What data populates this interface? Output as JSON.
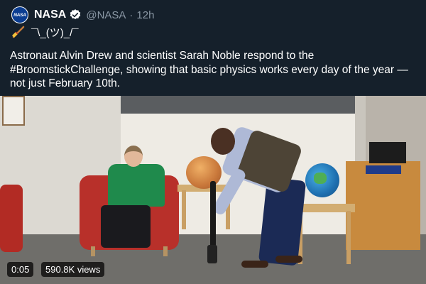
{
  "tweet": {
    "author": {
      "avatar_text": "NASA",
      "display_name": "NASA",
      "verified_icon": "verified-badge-icon",
      "handle": "@NASA",
      "separator": "·",
      "timestamp": "12h"
    },
    "emoji_line": {
      "emoji_icon": "broom-emoji-icon",
      "shrug": "¯\\_(ツ)_/¯"
    },
    "text": "Astronaut Alvin Drew and scientist Sarah Noble respond to the #BroomstickChallenge, showing that basic physics works every day of the year — not just February 10th."
  },
  "video": {
    "elapsed": "0:05",
    "views": "590.8K views"
  },
  "colors": {
    "background": "#15202b",
    "verified": "#1d9bf0",
    "secondary_text": "#8b98a5"
  }
}
